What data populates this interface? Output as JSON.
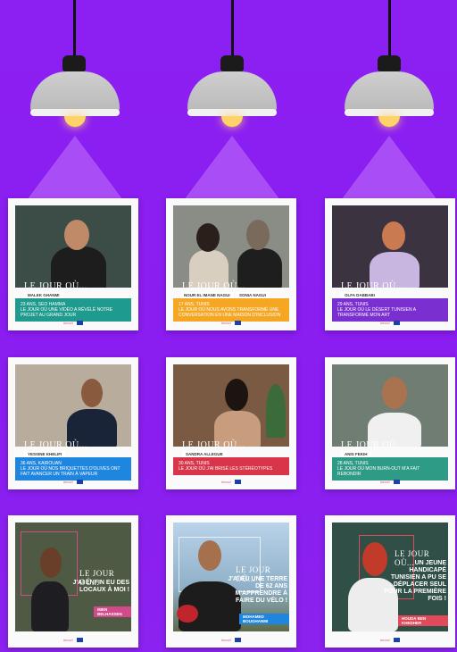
{
  "cards": [
    {
      "title": "LE JOUR OÙ...",
      "names": [
        "MALEK GHANMI"
      ],
      "subtitle": "23 ANS, SEO HAMMA",
      "text": "LE JOUR OÙ UNE VIDÉO A RÉVÉLÉ NOTRE PROJET AU GRAND JOUR"
    },
    {
      "title": "LE JOUR OÙ...",
      "names": [
        "NOUR EL IMANE NAGUI",
        "SONIA NAGUI"
      ],
      "subtitle": "17 ANS, TUNIS",
      "text": "LE JOUR OÙ NOUS AVONS TRANSFORMÉ UNE CONVERSATION EN UNE MAISON D'INCLUSION"
    },
    {
      "title": "LE JOUR OÙ...",
      "names": [
        "OLFA DABBABI"
      ],
      "subtitle": "29 ANS, TUNIS",
      "text": "LE JOUR OÙ LE DÉSERT TUNISIEN A TRANSFORMÉ MON ART"
    },
    {
      "title": "LE JOUR OÙ...",
      "names": [
        "YESSINE KHELIFI"
      ],
      "subtitle": "36 ANS, KAIROUAN",
      "text": "LE JOUR OÙ NOS BRIQUETTES D'OLIVES ONT FAIT AVANCER UN TRAIN À VAPEUR"
    },
    {
      "title": "LE JOUR OÙ...",
      "names": [
        "SANDRA ALLEGUE"
      ],
      "subtitle": "30 ANS, TUNIS",
      "text": "LE JOUR OÙ J'AI BRISÉ LES STÉRÉOTYPES"
    },
    {
      "title": "LE JOUR OÙ...",
      "names": [
        "ANIS FEKIH"
      ],
      "subtitle": "28 ANS, TUNIS",
      "text": "LE JOUR OÙ MON BURN-OUT M'A FAIT REBONDIR"
    },
    {
      "title": "LE JOUR OÙ...",
      "quote": "J'AI ENFIN EU DES LOCAUX À MOI !",
      "names": [
        "IMEN BELHASSEN"
      ]
    },
    {
      "title": "LE JOUR OÙ...",
      "quote": "J'AI EU UNE TERRE DE 62 ANS M'APPRENDRE À FAIRE DU VÉLO !",
      "names": [
        "MOHAMED BOUGHANMI"
      ]
    },
    {
      "title": "LE JOUR OÙ...",
      "quote": "UN JEUNE HANDICAPÉ TUNISIEN A PU SE DÉPLACER SEUL POUR LA PREMIÈRE FOIS !",
      "names": [
        "HOUDA BEN KHEDHER"
      ]
    }
  ],
  "footer_logo": "innov!",
  "colors": {
    "background": "#8a1df0",
    "teal": "#1f9a8e",
    "orange": "#f5a623",
    "purple": "#7a2fd0",
    "blue": "#1f86e0",
    "red": "#d8344a",
    "green": "#2e9b86"
  }
}
